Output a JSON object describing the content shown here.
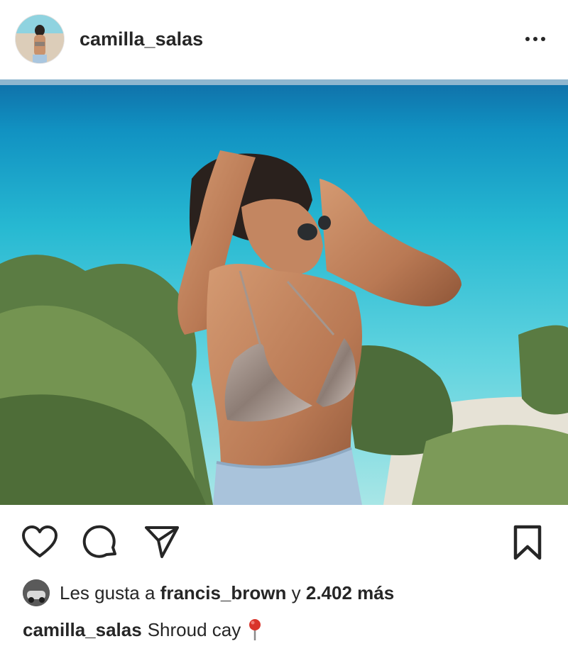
{
  "post": {
    "username": "camilla_salas",
    "more_icon": "more-horizontal-icon",
    "image_alt": "Woman in snakeskin bikini on a beach with turquoise sea"
  },
  "actions": {
    "like_icon": "heart-icon",
    "comment_icon": "comment-icon",
    "share_icon": "send-icon",
    "save_icon": "bookmark-icon"
  },
  "likes": {
    "prefix": "Les gusta a",
    "user": "francis_brown",
    "connector": "y",
    "count": "2.402 más"
  },
  "caption": {
    "username": "camilla_salas",
    "text": "Shroud cay",
    "emoji_icon": "round-pushpin-icon"
  },
  "colors": {
    "text": "#262626",
    "background": "#ffffff",
    "sea": "#2ec4d6",
    "pin_red": "#d9342b"
  }
}
